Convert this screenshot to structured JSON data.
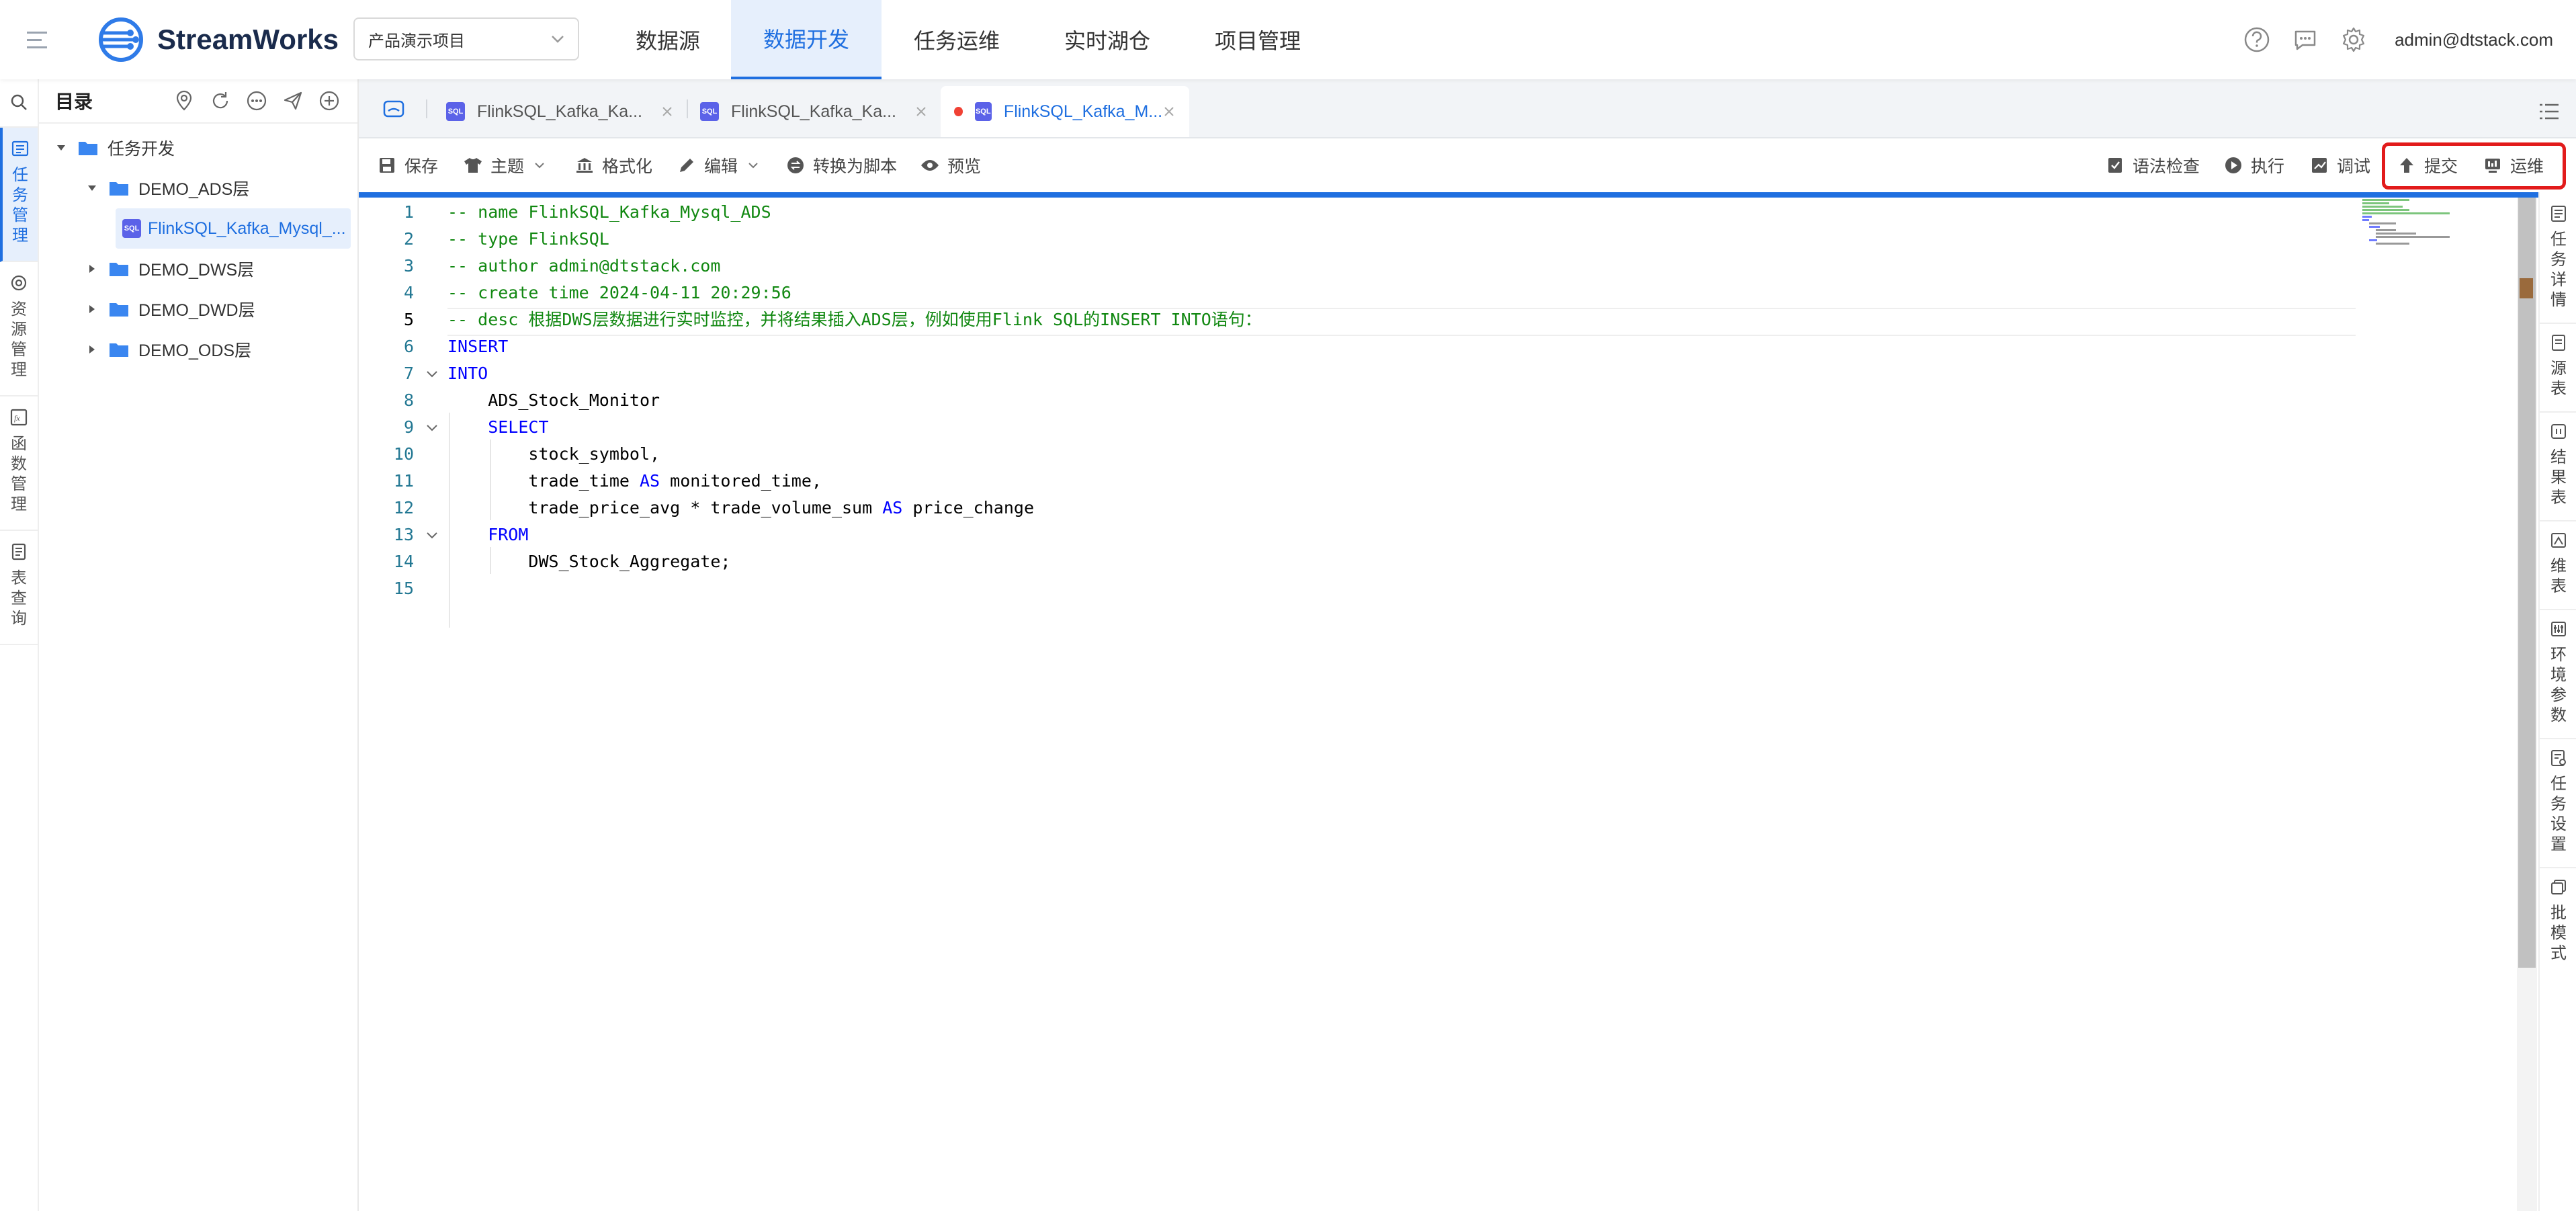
{
  "app": {
    "name": "StreamWorks"
  },
  "project_select": {
    "value": "产品演示项目"
  },
  "nav": [
    "数据源",
    "数据开发",
    "任务运维",
    "实时湖仓",
    "项目管理"
  ],
  "nav_active": "数据开发",
  "user": "admin@dtstack.com",
  "left_rail": [
    "任务管理",
    "资源管理",
    "函数管理",
    "表查询"
  ],
  "tree": {
    "title": "目录",
    "root": "任务开发",
    "folders": [
      {
        "label": "DEMO_ADS层",
        "expanded": true,
        "children": [
          "FlinkSQL_Kafka_Mysql_..."
        ]
      },
      {
        "label": "DEMO_DWS层",
        "expanded": false
      },
      {
        "label": "DEMO_DWD层",
        "expanded": false
      },
      {
        "label": "DEMO_ODS层",
        "expanded": false
      }
    ]
  },
  "tabs": [
    {
      "label": "FlinkSQL_Kafka_Ka...",
      "active": false
    },
    {
      "label": "FlinkSQL_Kafka_Ka...",
      "active": false
    },
    {
      "label": "FlinkSQL_Kafka_M...",
      "active": true,
      "unsaved": true
    }
  ],
  "toolbar": {
    "save": "保存",
    "theme": "主题",
    "format": "格式化",
    "edit": "编辑",
    "convert": "转换为脚本",
    "preview": "预览",
    "syntax_check": "语法检查",
    "run": "执行",
    "debug": "调试",
    "submit": "提交",
    "ops": "运维"
  },
  "code_lines": [
    {
      "n": "1",
      "text": "-- name FlinkSQL_Kafka_Mysql_ADS",
      "style": "cm"
    },
    {
      "n": "2",
      "text": "-- type FlinkSQL",
      "style": "cm"
    },
    {
      "n": "3",
      "text": "-- author admin@dtstack.com",
      "style": "cm"
    },
    {
      "n": "4",
      "text": "-- create time 2024-04-11 20:29:56",
      "style": "cm"
    },
    {
      "n": "5",
      "text": "-- desc 根据DWS层数据进行实时监控，并将结果插入ADS层，例如使用Flink SQL的INSERT INTO语句：",
      "style": "cm"
    },
    {
      "n": "6",
      "text": "INSERT",
      "style": "kw"
    },
    {
      "n": "7",
      "text": "INTO",
      "style": "kw"
    },
    {
      "n": "8",
      "text": "    ADS_Stock_Monitor",
      "style": "txt"
    },
    {
      "n": "9",
      "text": "    SELECT",
      "style": "kw"
    },
    {
      "n": "10",
      "text": "        stock_symbol,",
      "style": "txt"
    },
    {
      "n": "11",
      "text": "        trade_time AS monitored_time,",
      "style": "txt"
    },
    {
      "n": "12",
      "text": "        trade_price_avg * trade_volume_sum AS price_change",
      "style": "txt"
    },
    {
      "n": "13",
      "text": "    FROM",
      "style": "kw"
    },
    {
      "n": "14",
      "text": "        DWS_Stock_Aggregate;",
      "style": "txt"
    },
    {
      "n": "15",
      "text": "",
      "style": "txt"
    }
  ],
  "right_rail": [
    "任务详情",
    "源表",
    "结果表",
    "维表",
    "环境参数",
    "任务设置",
    "批模式"
  ],
  "colors": {
    "accent": "#1f6fe0",
    "highlight_border": "#e21b1b",
    "sql_badge": "#5b62e8"
  }
}
